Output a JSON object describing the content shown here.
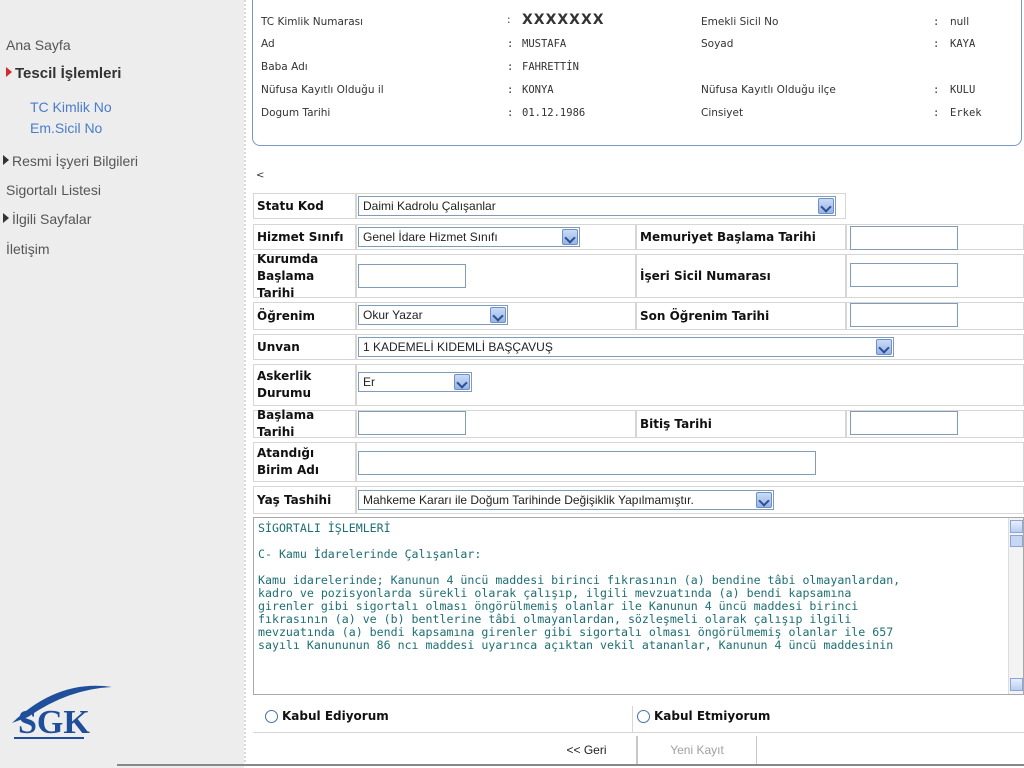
{
  "sidebar": {
    "items": [
      {
        "label": "Ana Sayfa"
      },
      {
        "label": "Tescil İşlemleri"
      },
      {
        "label": "TC Kimlik No"
      },
      {
        "label": "Em.Sicil No"
      },
      {
        "label": "Resmi İşyeri Bilgileri"
      },
      {
        "label": "Sigortalı Listesi"
      },
      {
        "label": "İlgili Sayfalar"
      },
      {
        "label": "İletişim"
      }
    ],
    "logo_text": "SGK"
  },
  "info": {
    "tc_label": "TC Kimlik Numarası",
    "tc_value": "XXXXXXX",
    "emekli_label": "Emekli Sicil No",
    "emekli_value": "null",
    "ad_label": "Ad",
    "ad_value": "MUSTAFA",
    "soyad_label": "Soyad",
    "soyad_value": "KAYA",
    "baba_label": "Baba Adı",
    "baba_value": "FAHRETTİN",
    "il_label": "Nüfusa Kayıtlı Olduğu il",
    "il_value": "KONYA",
    "ilce_label": "Nüfusa Kayıtlı Olduğu ilçe",
    "ilce_value": "KULU",
    "dogum_label": "Dogum Tarihi",
    "dogum_value": "01.12.1986",
    "cinsiyet_label": "Cinsiyet",
    "cinsiyet_value": "Erkek",
    "colon": ":"
  },
  "back_link": "<",
  "form": {
    "statu_label": "Statu Kod",
    "statu_value": "Daimi Kadrolu Çalışanlar",
    "hizmet_label": "Hizmet Sınıfı",
    "hizmet_value": "Genel İdare Hizmet Sınıfı",
    "memuriyet_label": "Memuriyet Başlama Tarihi",
    "kurumda_label": "Kurumda Başlama Tarihi",
    "iseri_label": "İşeri Sicil Numarası",
    "ogrenim_label": "Öğrenim",
    "ogrenim_value": "Okur Yazar",
    "son_ogrenim_label": "Son Öğrenim Tarihi",
    "unvan_label": "Unvan",
    "unvan_value": "1 KADEMELİ KIDEMLİ BAŞÇAVUŞ",
    "askerlik_label": "Askerlik Durumu",
    "askerlik_value": "Er",
    "baslama_label": "Başlama Tarihi",
    "bitis_label": "Bitiş Tarihi",
    "birim_label": "Atandığı Birim Adı",
    "yas_label": "Yaş Tashihi",
    "yas_value": "Mahkeme Kararı ile Doğum Tarihinde Değişiklik Yapılmamıştır."
  },
  "terms_text": "SİGORTALI İŞLEMLERİ\n\nC- Kamu İdarelerinde Çalışanlar:\n\nKamu idarelerinde; Kanunun 4 üncü maddesi birinci fıkrasının (a) bendine tâbi olmayanlardan,\nkadro ve pozisyonlarda sürekli olarak çalışıp, ilgili mevzuatında (a) bendi kapsamına\ngirenler gibi sigortalı olması öngörülmemiş olanlar ile Kanunun 4 üncü maddesi birinci\nfıkrasının (a) ve (b) bentlerine tâbi olmayanlardan, sözleşmeli olarak çalışıp ilgili\nmevzuatında (a) bendi kapsamına girenler gibi sigortalı olması öngörülmemiş olanlar ile 657\nsayılı Kanununun 86 ncı maddesi uyarınca açıktan vekil atananlar, Kanunun 4 üncü maddesinin",
  "radios": {
    "accept": "Kabul Ediyorum",
    "reject": "Kabul Etmiyorum"
  },
  "buttons": {
    "back": "<< Geri",
    "new": "Yeni Kayıt"
  }
}
